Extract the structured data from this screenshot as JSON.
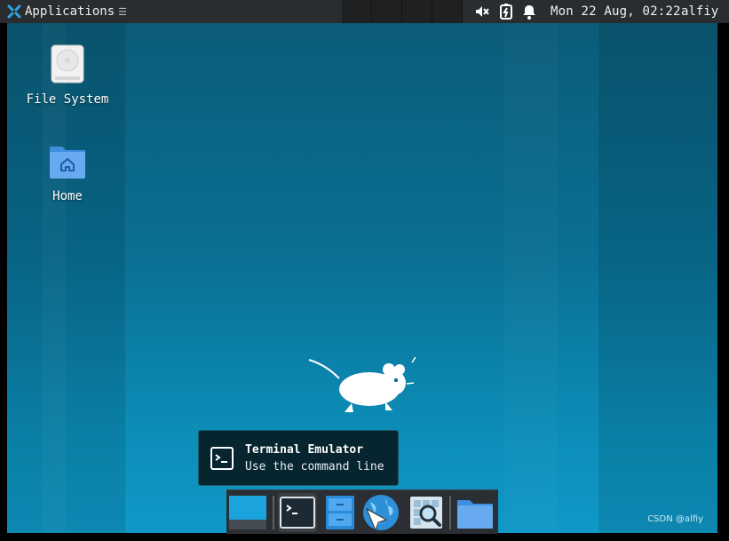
{
  "panel": {
    "applications_label": "Applications",
    "menu_extra": "☰",
    "clock": "Mon 22 Aug, 02:22",
    "user": "alfiy",
    "tray_icons": [
      "volume-muted-icon",
      "battery-charging-icon",
      "notification-bell-icon"
    ]
  },
  "desktop": {
    "icons": [
      {
        "label": "File System",
        "icon": "hard-drive-icon"
      },
      {
        "label": "Home",
        "icon": "home-folder-icon"
      }
    ]
  },
  "tooltip": {
    "title": "Terminal Emulator",
    "subtitle": "Use the command line"
  },
  "dock": {
    "items": [
      {
        "name": "show-desktop-icon"
      },
      {
        "name": "terminal-icon"
      },
      {
        "name": "file-manager-icon"
      },
      {
        "name": "web-browser-icon"
      },
      {
        "name": "app-finder-icon"
      },
      {
        "name": "folder-icon"
      }
    ]
  },
  "watermark": "CSDN @alfiy",
  "colors": {
    "panel": "#2a2d30",
    "desktop": "#0a6f93",
    "tooltip_bg": "#06252f",
    "accent": "#1aa3dc"
  }
}
